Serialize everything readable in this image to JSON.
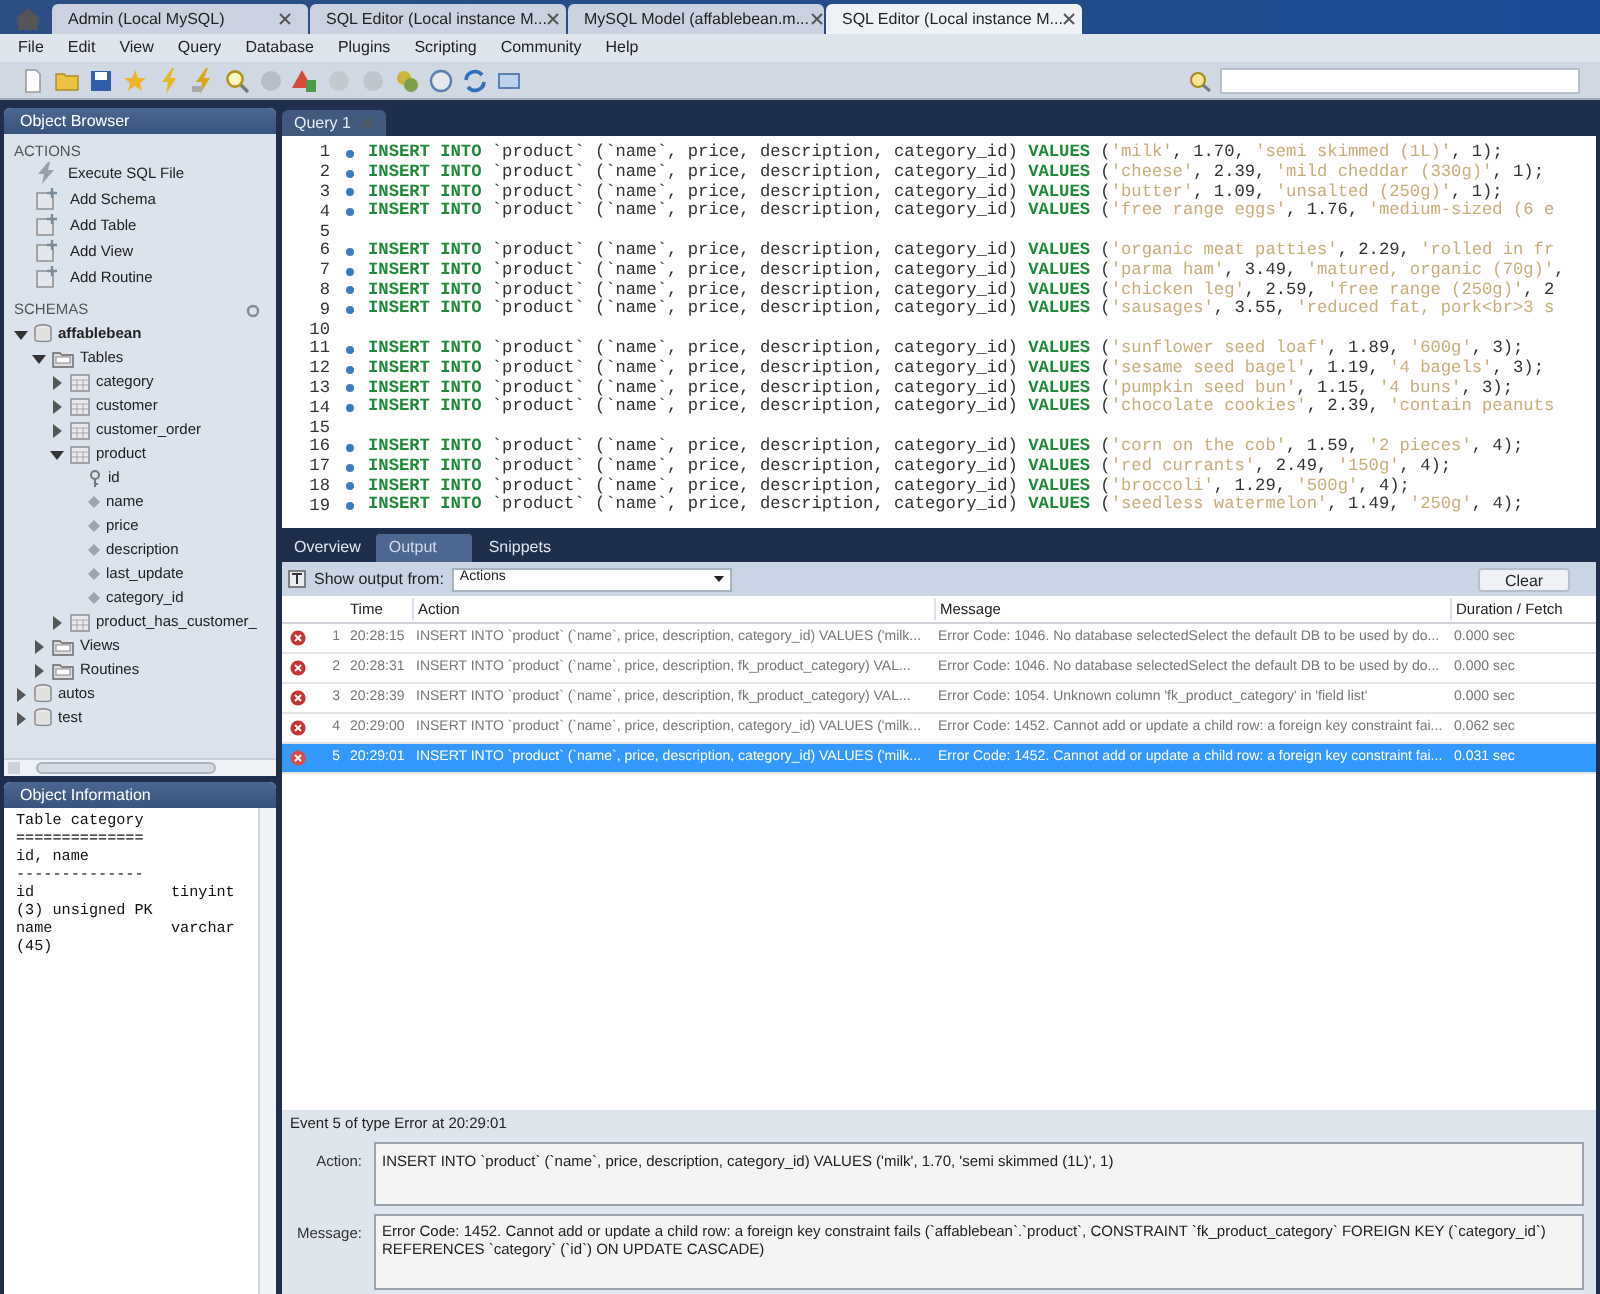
{
  "window_tabs": [
    {
      "label": "Admin (Local MySQL)",
      "selected": false
    },
    {
      "label": "SQL Editor (Local instance M...",
      "selected": false
    },
    {
      "label": "MySQL Model (affablebean.m...",
      "selected": false
    },
    {
      "label": "SQL Editor (Local instance M...",
      "selected": true
    }
  ],
  "menu": [
    "File",
    "Edit",
    "View",
    "Query",
    "Database",
    "Plugins",
    "Scripting",
    "Community",
    "Help"
  ],
  "object_browser": {
    "title": "Object Browser",
    "actions_heading": "ACTIONS",
    "actions": [
      "Execute SQL File",
      "Add Schema",
      "Add Table",
      "Add View",
      "Add Routine"
    ],
    "schemas_heading": "SCHEMAS",
    "tree": [
      {
        "label": "affablebean",
        "kind": "schema",
        "active": true,
        "expanded": true,
        "children": [
          {
            "label": "Tables",
            "kind": "folder",
            "expanded": true,
            "children": [
              {
                "label": "category",
                "kind": "table",
                "expanded": false
              },
              {
                "label": "customer",
                "kind": "table",
                "expanded": false
              },
              {
                "label": "customer_order",
                "kind": "table",
                "expanded": false
              },
              {
                "label": "product",
                "kind": "table",
                "expanded": true,
                "children": [
                  {
                    "label": "id",
                    "kind": "key"
                  },
                  {
                    "label": "name",
                    "kind": "column"
                  },
                  {
                    "label": "price",
                    "kind": "column"
                  },
                  {
                    "label": "description",
                    "kind": "column"
                  },
                  {
                    "label": "last_update",
                    "kind": "column"
                  },
                  {
                    "label": "category_id",
                    "kind": "column"
                  }
                ]
              },
              {
                "label": "product_has_customer_",
                "kind": "table",
                "expanded": false
              }
            ]
          },
          {
            "label": "Views",
            "kind": "folder",
            "expanded": false
          },
          {
            "label": "Routines",
            "kind": "folder",
            "expanded": false
          }
        ]
      },
      {
        "label": "autos",
        "kind": "schema",
        "active": false,
        "expanded": false
      },
      {
        "label": "test",
        "kind": "schema",
        "active": false,
        "expanded": false
      }
    ]
  },
  "object_information": {
    "title": "Object Information",
    "lines": [
      "Table category",
      "==============",
      "id, name",
      "--------------",
      "id               tinyint",
      "(3) unsigned PK",
      "name             varchar",
      "(45)"
    ]
  },
  "query_tab": {
    "label": "Query 1"
  },
  "editor": {
    "lines": [
      {
        "number": "1",
        "code": [
          {
            "kind": "keyword",
            "text": "INSERT INTO"
          },
          {
            "kind": "plain",
            "text": " `product` (`name`, price, description, category_id) "
          },
          {
            "kind": "keyword",
            "text": "VALUES"
          },
          {
            "kind": "plain",
            "text": " ("
          },
          {
            "kind": "string",
            "text": "'milk'"
          },
          {
            "kind": "plain",
            "text": ", 1.70, "
          },
          {
            "kind": "string",
            "text": "'semi skimmed (1L)'"
          },
          {
            "kind": "plain",
            "text": ", 1);"
          }
        ]
      },
      {
        "number": "2",
        "code": [
          {
            "kind": "keyword",
            "text": "INSERT INTO"
          },
          {
            "kind": "plain",
            "text": " `product` (`name`, price, description, category_id) "
          },
          {
            "kind": "keyword",
            "text": "VALUES"
          },
          {
            "kind": "plain",
            "text": " ("
          },
          {
            "kind": "string",
            "text": "'cheese'"
          },
          {
            "kind": "plain",
            "text": ", 2.39, "
          },
          {
            "kind": "string",
            "text": "'mild cheddar (330g)'"
          },
          {
            "kind": "plain",
            "text": ", 1);"
          }
        ]
      },
      {
        "number": "3",
        "code": [
          {
            "kind": "keyword",
            "text": "INSERT INTO"
          },
          {
            "kind": "plain",
            "text": " `product` (`name`, price, description, category_id) "
          },
          {
            "kind": "keyword",
            "text": "VALUES"
          },
          {
            "kind": "plain",
            "text": " ("
          },
          {
            "kind": "string",
            "text": "'butter'"
          },
          {
            "kind": "plain",
            "text": ", 1.09, "
          },
          {
            "kind": "string",
            "text": "'unsalted (250g)'"
          },
          {
            "kind": "plain",
            "text": ", 1);"
          }
        ]
      },
      {
        "number": "4",
        "code": [
          {
            "kind": "keyword",
            "text": "INSERT INTO"
          },
          {
            "kind": "plain",
            "text": " `product` (`name`, price, description, category_id) "
          },
          {
            "kind": "keyword",
            "text": "VALUES"
          },
          {
            "kind": "plain",
            "text": " ("
          },
          {
            "kind": "string",
            "text": "'free range eggs'"
          },
          {
            "kind": "plain",
            "text": ", 1.76, "
          },
          {
            "kind": "string",
            "text": "'medium-sized (6 e"
          }
        ]
      },
      {
        "number": "5"
      },
      {
        "number": "6",
        "code": [
          {
            "kind": "keyword",
            "text": "INSERT INTO"
          },
          {
            "kind": "plain",
            "text": " `product` (`name`, price, description, category_id) "
          },
          {
            "kind": "keyword",
            "text": "VALUES"
          },
          {
            "kind": "plain",
            "text": " ("
          },
          {
            "kind": "string",
            "text": "'organic meat patties'"
          },
          {
            "kind": "plain",
            "text": ", 2.29, "
          },
          {
            "kind": "string",
            "text": "'rolled in fr"
          }
        ]
      },
      {
        "number": "7",
        "code": [
          {
            "kind": "keyword",
            "text": "INSERT INTO"
          },
          {
            "kind": "plain",
            "text": " `product` (`name`, price, description, category_id) "
          },
          {
            "kind": "keyword",
            "text": "VALUES"
          },
          {
            "kind": "plain",
            "text": " ("
          },
          {
            "kind": "string",
            "text": "'parma ham'"
          },
          {
            "kind": "plain",
            "text": ", 3.49, "
          },
          {
            "kind": "string",
            "text": "'matured, organic (70g)'"
          },
          {
            "kind": "plain",
            "text": ","
          }
        ]
      },
      {
        "number": "8",
        "code": [
          {
            "kind": "keyword",
            "text": "INSERT INTO"
          },
          {
            "kind": "plain",
            "text": " `product` (`name`, price, description, category_id) "
          },
          {
            "kind": "keyword",
            "text": "VALUES"
          },
          {
            "kind": "plain",
            "text": " ("
          },
          {
            "kind": "string",
            "text": "'chicken leg'"
          },
          {
            "kind": "plain",
            "text": ", 2.59, "
          },
          {
            "kind": "string",
            "text": "'free range (250g)'"
          },
          {
            "kind": "plain",
            "text": ", 2"
          }
        ]
      },
      {
        "number": "9",
        "code": [
          {
            "kind": "keyword",
            "text": "INSERT INTO"
          },
          {
            "kind": "plain",
            "text": " `product` (`name`, price, description, category_id) "
          },
          {
            "kind": "keyword",
            "text": "VALUES"
          },
          {
            "kind": "plain",
            "text": " ("
          },
          {
            "kind": "string",
            "text": "'sausages'"
          },
          {
            "kind": "plain",
            "text": ", 3.55, "
          },
          {
            "kind": "string",
            "text": "'reduced fat, pork<br>3 s"
          }
        ]
      },
      {
        "number": "10"
      },
      {
        "number": "11",
        "code": [
          {
            "kind": "keyword",
            "text": "INSERT INTO"
          },
          {
            "kind": "plain",
            "text": " `product` (`name`, price, description, category_id) "
          },
          {
            "kind": "keyword",
            "text": "VALUES"
          },
          {
            "kind": "plain",
            "text": " ("
          },
          {
            "kind": "string",
            "text": "'sunflower seed loaf'"
          },
          {
            "kind": "plain",
            "text": ", 1.89, "
          },
          {
            "kind": "string",
            "text": "'600g'"
          },
          {
            "kind": "plain",
            "text": ", 3);"
          }
        ]
      },
      {
        "number": "12",
        "code": [
          {
            "kind": "keyword",
            "text": "INSERT INTO"
          },
          {
            "kind": "plain",
            "text": " `product` (`name`, price, description, category_id) "
          },
          {
            "kind": "keyword",
            "text": "VALUES"
          },
          {
            "kind": "plain",
            "text": " ("
          },
          {
            "kind": "string",
            "text": "'sesame seed bagel'"
          },
          {
            "kind": "plain",
            "text": ", 1.19, "
          },
          {
            "kind": "string",
            "text": "'4 bagels'"
          },
          {
            "kind": "plain",
            "text": ", 3);"
          }
        ]
      },
      {
        "number": "13",
        "code": [
          {
            "kind": "keyword",
            "text": "INSERT INTO"
          },
          {
            "kind": "plain",
            "text": " `product` (`name`, price, description, category_id) "
          },
          {
            "kind": "keyword",
            "text": "VALUES"
          },
          {
            "kind": "plain",
            "text": " ("
          },
          {
            "kind": "string",
            "text": "'pumpkin seed bun'"
          },
          {
            "kind": "plain",
            "text": ", 1.15, "
          },
          {
            "kind": "string",
            "text": "'4 buns'"
          },
          {
            "kind": "plain",
            "text": ", 3);"
          }
        ]
      },
      {
        "number": "14",
        "code": [
          {
            "kind": "keyword",
            "text": "INSERT INTO"
          },
          {
            "kind": "plain",
            "text": " `product` (`name`, price, description, category_id) "
          },
          {
            "kind": "keyword",
            "text": "VALUES"
          },
          {
            "kind": "plain",
            "text": " ("
          },
          {
            "kind": "string",
            "text": "'chocolate cookies'"
          },
          {
            "kind": "plain",
            "text": ", 2.39, "
          },
          {
            "kind": "string",
            "text": "'contain peanuts"
          }
        ]
      },
      {
        "number": "15"
      },
      {
        "number": "16",
        "code": [
          {
            "kind": "keyword",
            "text": "INSERT INTO"
          },
          {
            "kind": "plain",
            "text": " `product` (`name`, price, description, category_id) "
          },
          {
            "kind": "keyword",
            "text": "VALUES"
          },
          {
            "kind": "plain",
            "text": " ("
          },
          {
            "kind": "string",
            "text": "'corn on the cob'"
          },
          {
            "kind": "plain",
            "text": ", 1.59, "
          },
          {
            "kind": "string",
            "text": "'2 pieces'"
          },
          {
            "kind": "plain",
            "text": ", 4);"
          }
        ]
      },
      {
        "number": "17",
        "code": [
          {
            "kind": "keyword",
            "text": "INSERT INTO"
          },
          {
            "kind": "plain",
            "text": " `product` (`name`, price, description, category_id) "
          },
          {
            "kind": "keyword",
            "text": "VALUES"
          },
          {
            "kind": "plain",
            "text": " ("
          },
          {
            "kind": "string",
            "text": "'red currants'"
          },
          {
            "kind": "plain",
            "text": ", 2.49, "
          },
          {
            "kind": "string",
            "text": "'150g'"
          },
          {
            "kind": "plain",
            "text": ", 4);"
          }
        ]
      },
      {
        "number": "18",
        "code": [
          {
            "kind": "keyword",
            "text": "INSERT INTO"
          },
          {
            "kind": "plain",
            "text": " `product` (`name`, price, description, category_id) "
          },
          {
            "kind": "keyword",
            "text": "VALUES"
          },
          {
            "kind": "plain",
            "text": " ("
          },
          {
            "kind": "string",
            "text": "'broccoli'"
          },
          {
            "kind": "plain",
            "text": ", 1.29, "
          },
          {
            "kind": "string",
            "text": "'500g'"
          },
          {
            "kind": "plain",
            "text": ", 4);"
          }
        ]
      },
      {
        "number": "19",
        "code": [
          {
            "kind": "keyword",
            "text": "INSERT INTO"
          },
          {
            "kind": "plain",
            "text": " `product` (`name`, price, description, category_id) "
          },
          {
            "kind": "keyword",
            "text": "VALUES"
          },
          {
            "kind": "plain",
            "text": " ("
          },
          {
            "kind": "string",
            "text": "'seedless watermelon'"
          },
          {
            "kind": "plain",
            "text": ", 1.49, "
          },
          {
            "kind": "string",
            "text": "'250g'"
          },
          {
            "kind": "plain",
            "text": ", 4);"
          }
        ]
      }
    ]
  },
  "output": {
    "tabs": [
      {
        "label": "Overview",
        "selected": false
      },
      {
        "label": "Output",
        "selected": true
      },
      {
        "label": "Snippets",
        "selected": false
      }
    ],
    "show_from_label": "Show output from:",
    "show_from_value": "Actions",
    "clear_button": "Clear",
    "columns": [
      "Time",
      "Action",
      "Message",
      "Duration / Fetch"
    ],
    "rows": [
      {
        "number": "1",
        "time": "20:28:15",
        "action": "INSERT INTO `product` (`name`, price, description, category_id) VALUES ('milk...",
        "message": "Error Code: 1046. No database selectedSelect the default DB to be used by do...",
        "duration": "0.000 sec",
        "selected": false
      },
      {
        "number": "2",
        "time": "20:28:31",
        "action": "INSERT INTO `product` (`name`, price, description, fk_product_category) VAL...",
        "message": "Error Code: 1046. No database selectedSelect the default DB to be used by do...",
        "duration": "0.000 sec",
        "selected": false
      },
      {
        "number": "3",
        "time": "20:28:39",
        "action": "INSERT INTO `product` (`name`, price, description, fk_product_category) VAL...",
        "message": "Error Code: 1054. Unknown column 'fk_product_category' in 'field list'",
        "duration": "0.000 sec",
        "selected": false
      },
      {
        "number": "4",
        "time": "20:29:00",
        "action": "INSERT INTO `product` (`name`, price, description, category_id) VALUES ('milk...",
        "message": "Error Code: 1452. Cannot add or update a child row: a foreign key constraint fai...",
        "duration": "0.062 sec",
        "selected": false
      },
      {
        "number": "5",
        "time": "20:29:01",
        "action": "INSERT INTO `product` (`name`, price, description, category_id) VALUES ('milk...",
        "message": "Error Code: 1452. Cannot add or update a child row: a foreign key constraint fai...",
        "duration": "0.031 sec",
        "selected": true
      }
    ],
    "event": "Event 5 of type Error at 20:29:01",
    "action_label": "Action:",
    "action_text": "INSERT INTO `product` (`name`, price, description, category_id) VALUES ('milk', 1.70, 'semi skimmed (1L)', 1)",
    "message_label": "Message:",
    "message_text": "Error Code: 1452. Cannot add or update a child row: a foreign key constraint fails (`affablebean`.`product`, CONSTRAINT `fk_product_category` FOREIGN KEY (`category_id`) REFERENCES `category` (`id`) ON UPDATE CASCADE)"
  }
}
